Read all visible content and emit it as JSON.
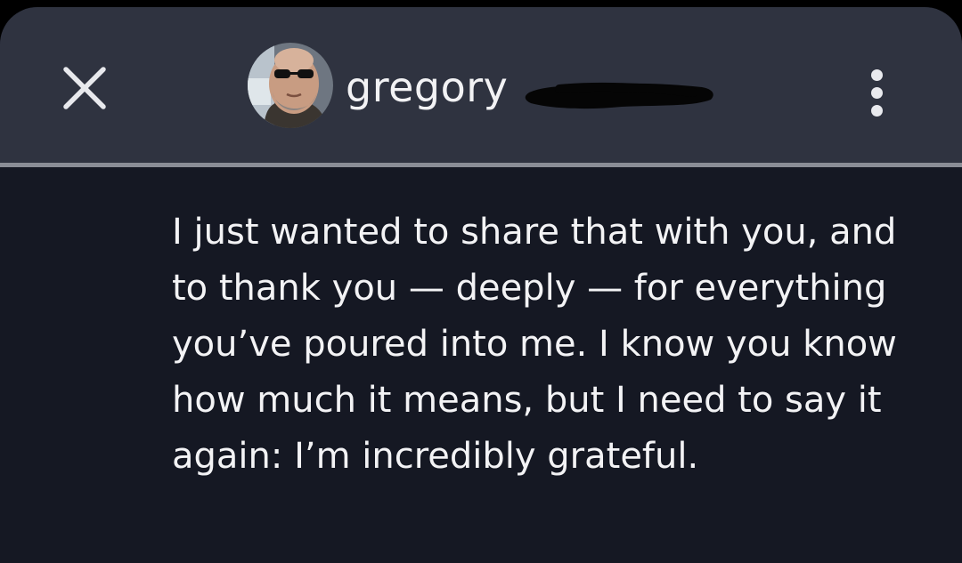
{
  "header": {
    "username": "gregory",
    "close_icon": "close-icon",
    "more_icon": "more-vertical-icon",
    "username_redacted": true
  },
  "message": {
    "text": "I just wanted to share that with you, and to thank you — deeply — for everything you’ve poured into me. I know you know how much it means, but I need to say it again: I’m incredibly grateful."
  },
  "colors": {
    "header_bg": "#2f3340",
    "body_bg": "#151823",
    "text": "#f3f3f5",
    "divider": "#8a8d96"
  }
}
